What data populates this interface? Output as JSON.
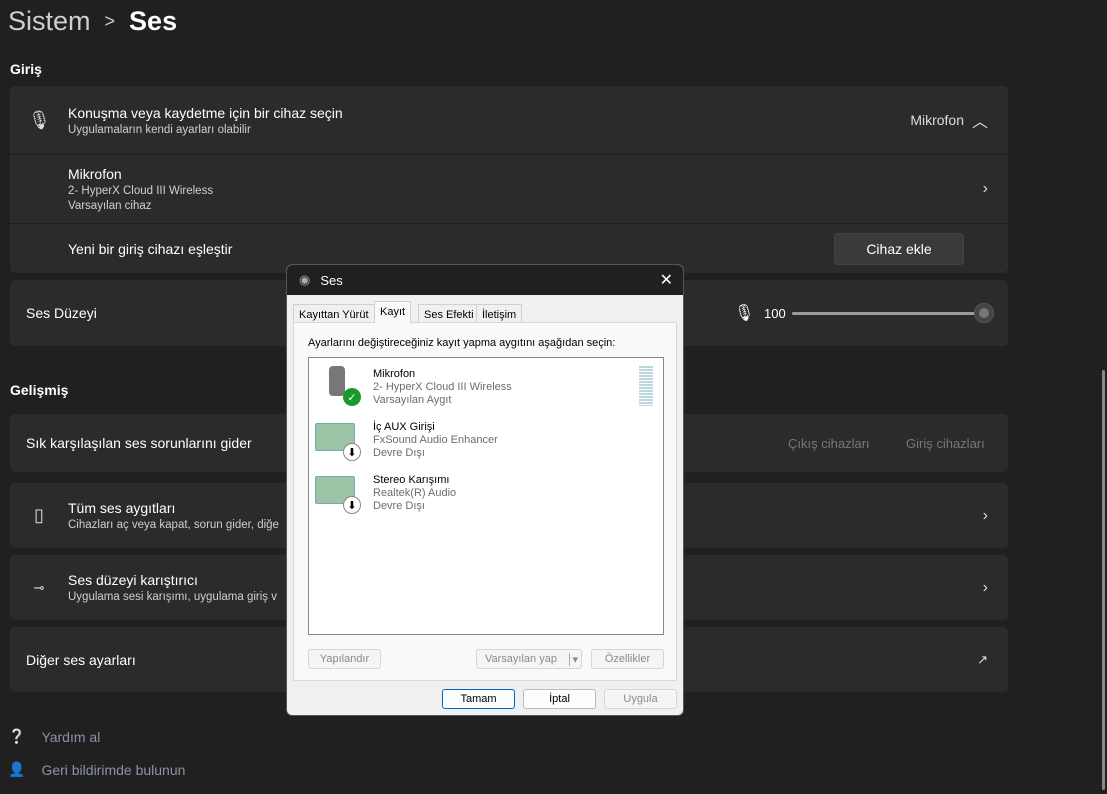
{
  "breadcrumb": {
    "parent": "Sistem",
    "separator": ">",
    "current": "Ses"
  },
  "input": {
    "section": "Giriş",
    "choose_title": "Konuşma veya kaydetme için bir cihaz seçin",
    "choose_sub": "Uygulamaların kendi ayarları olabilir",
    "choose_value": "Mikrofon",
    "device_name": "Mikrofon",
    "device_model": "2- HyperX Cloud III Wireless",
    "device_status": "Varsayılan cihaz",
    "pair_label": "Yeni bir giriş cihazı eşleştir",
    "pair_button": "Cihaz ekle",
    "volume_label": "Ses Düzeyi",
    "volume_value": "100",
    "volume_percent": 100
  },
  "advanced": {
    "section": "Gelişmiş",
    "troubleshoot": "Sık karşılaşılan ses sorunlarını gider",
    "out_devices": "Çıkış cihazları",
    "in_devices": "Giriş cihazları",
    "all_devices_title": "Tüm ses aygıtları",
    "all_devices_sub": "Cihazları aç veya kapat, sorun gider, diğe",
    "mixer_title": "Ses düzeyi karıştırıcı",
    "mixer_sub": "Uygulama sesi karışımı, uygulama giriş v",
    "more": "Diğer ses ayarları"
  },
  "footer": {
    "help": "Yardım al",
    "feedback": "Geri bildirimde bulunun"
  },
  "dialog": {
    "title": "Ses",
    "tabs": [
      "Kayıttan Yürüt",
      "Kayıt",
      "Ses Efekti",
      "İletişim"
    ],
    "instruction": "Ayarlarını değiştireceğiniz kayıt yapma aygıtını aşağıdan seçin:",
    "devices": [
      {
        "name": "Mikrofon",
        "model": "2- HyperX Cloud III Wireless",
        "status": "Varsayılan Aygıt"
      },
      {
        "name": "İç AUX Girişi",
        "model": "FxSound Audio Enhancer",
        "status": "Devre Dışı"
      },
      {
        "name": "Stereo Karışımı",
        "model": "Realtek(R) Audio",
        "status": "Devre Dışı"
      }
    ],
    "configure": "Yapılandır",
    "set_default": "Varsayılan yap",
    "properties": "Özellikler",
    "ok": "Tamam",
    "cancel": "İptal",
    "apply": "Uygula"
  }
}
